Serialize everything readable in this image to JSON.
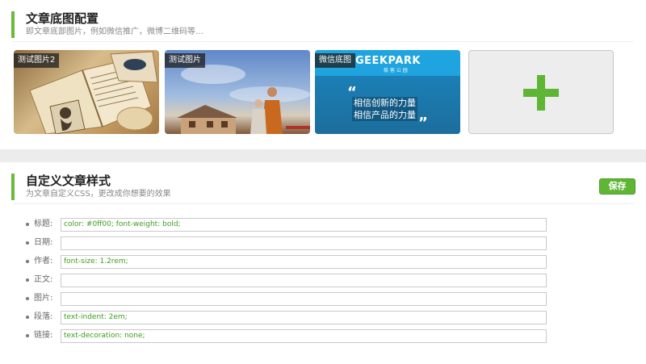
{
  "bg_config": {
    "title": "文章底图配置",
    "subtitle": "即文章底部图片，例如微信推广，微博二维码等…",
    "images": [
      {
        "label": "测试图片2"
      },
      {
        "label": "测试图片"
      },
      {
        "label": "微信底图",
        "logo": "GEEKPARK",
        "logo_sub": "极 客 公 园",
        "quote_line1": "相信创新的力量",
        "quote_line2": "相信产品的力量"
      }
    ],
    "add_icon": "plus-icon"
  },
  "custom_style": {
    "title": "自定义文章样式",
    "subtitle": "为文章自定义CSS，更改成你想要的效果",
    "save_label": "保存",
    "fields": [
      {
        "label": "标题:",
        "value": "color: #0ff00; font-weight: bold;"
      },
      {
        "label": "日期:",
        "value": ""
      },
      {
        "label": "作者:",
        "value": "font-size: 1.2rem;"
      },
      {
        "label": "正文:",
        "value": ""
      },
      {
        "label": "图片:",
        "value": ""
      },
      {
        "label": "段落:",
        "value": "text-indent: 2em;"
      },
      {
        "label": "链接:",
        "value": "text-decoration: none;"
      }
    ]
  },
  "colors": {
    "accent": "#6abb3a",
    "input_text": "#3f9c20"
  }
}
